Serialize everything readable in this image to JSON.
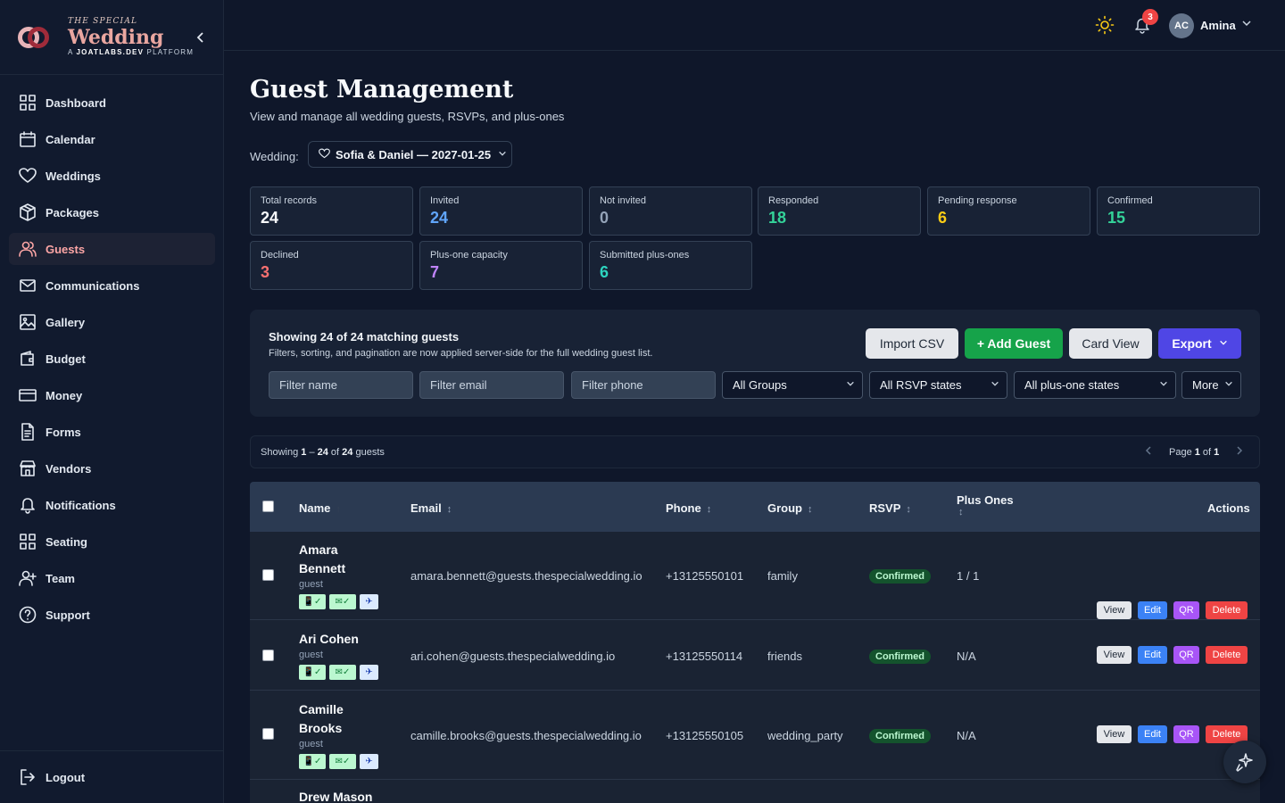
{
  "brand": {
    "top": "THE SPECIAL",
    "main": "Wedding",
    "sub_prefix": "A ",
    "sub_bold": "JOATLABS.DEV",
    "sub_suffix": " PLATFORM"
  },
  "sidebar": {
    "items": [
      {
        "label": "Dashboard",
        "icon": "dashboard-icon"
      },
      {
        "label": "Calendar",
        "icon": "calendar-icon"
      },
      {
        "label": "Weddings",
        "icon": "heart-icon"
      },
      {
        "label": "Packages",
        "icon": "package-icon"
      },
      {
        "label": "Guests",
        "icon": "users-icon",
        "active": true
      },
      {
        "label": "Communications",
        "icon": "mail-icon"
      },
      {
        "label": "Gallery",
        "icon": "image-icon"
      },
      {
        "label": "Budget",
        "icon": "wallet-icon"
      },
      {
        "label": "Money",
        "icon": "card-icon"
      },
      {
        "label": "Forms",
        "icon": "document-icon"
      },
      {
        "label": "Vendors",
        "icon": "store-icon"
      },
      {
        "label": "Notifications",
        "icon": "bell-icon"
      },
      {
        "label": "Seating",
        "icon": "grid-icon"
      },
      {
        "label": "Team",
        "icon": "user-plus-icon"
      },
      {
        "label": "Support",
        "icon": "help-icon"
      }
    ],
    "logout": "Logout"
  },
  "topbar": {
    "notification_count": "3",
    "avatar_initials": "AC",
    "user_name": "Amina"
  },
  "page": {
    "title": "Guest Management",
    "subtitle": "View and manage all wedding guests, RSVPs, and plus-ones",
    "wedding_label": "Wedding:",
    "wedding_value": "Sofia & Daniel — 2027-01-25"
  },
  "stats": [
    {
      "label": "Total records",
      "value": "24",
      "color": "#f8fafc"
    },
    {
      "label": "Invited",
      "value": "24",
      "color": "#60a5fa"
    },
    {
      "label": "Not invited",
      "value": "0",
      "color": "#94a3b8"
    },
    {
      "label": "Responded",
      "value": "18",
      "color": "#34d399"
    },
    {
      "label": "Pending response",
      "value": "6",
      "color": "#facc15"
    },
    {
      "label": "Confirmed",
      "value": "15",
      "color": "#34d399"
    },
    {
      "label": "Declined",
      "value": "3",
      "color": "#f87171"
    },
    {
      "label": "Plus-one capacity",
      "value": "7",
      "color": "#c084fc"
    },
    {
      "label": "Submitted plus-ones",
      "value": "6",
      "color": "#2dd4bf"
    }
  ],
  "toolbar": {
    "title": "Showing 24 of 24 matching guests",
    "subtitle": "Filters, sorting, and pagination are now applied server-side for the full wedding guest list.",
    "import_label": "Import CSV",
    "add_label": "+ Add Guest",
    "card_label": "Card View",
    "export_label": "Export",
    "filter_name_placeholder": "Filter name",
    "filter_email_placeholder": "Filter email",
    "filter_phone_placeholder": "Filter phone",
    "group_select": "All Groups",
    "rsvp_select": "All RSVP states",
    "plusone_select": "All plus-one states",
    "more_label": "More"
  },
  "pager": {
    "prefix": "Showing ",
    "from": "1",
    "sep": " – ",
    "to": "24",
    "of": " of ",
    "total": "24",
    "suffix": " guests",
    "page_prefix": "Page ",
    "page": "1",
    "page_of": " of ",
    "pages": "1"
  },
  "table": {
    "columns": {
      "name": "Name",
      "email": "Email",
      "phone": "Phone",
      "group": "Group",
      "rsvp": "RSVP",
      "plus_ones": "Plus Ones",
      "actions": "Actions"
    },
    "actions": {
      "view": "View",
      "edit": "Edit",
      "qr": "QR",
      "delete": "Delete"
    },
    "rows": [
      {
        "name": "Amara Bennett",
        "role": "guest",
        "email": "amara.bennett@guests.thespecialwedding.io",
        "phone": "+13125550101",
        "group": "family",
        "rsvp": "Confirmed",
        "plus_ones": "1 / 1"
      },
      {
        "name": "Ari Cohen",
        "role": "guest",
        "email": "ari.cohen@guests.thespecialwedding.io",
        "phone": "+13125550114",
        "group": "friends",
        "rsvp": "Confirmed",
        "plus_ones": "N/A"
      },
      {
        "name": "Camille Brooks",
        "role": "guest",
        "email": "camille.brooks@guests.thespecialwedding.io",
        "phone": "+13125550105",
        "group": "wedding_party",
        "rsvp": "Confirmed",
        "plus_ones": "N/A"
      },
      {
        "name": "Drew Mason",
        "role": "",
        "email": "",
        "phone": "",
        "group": "",
        "rsvp": "",
        "plus_ones": ""
      }
    ]
  }
}
